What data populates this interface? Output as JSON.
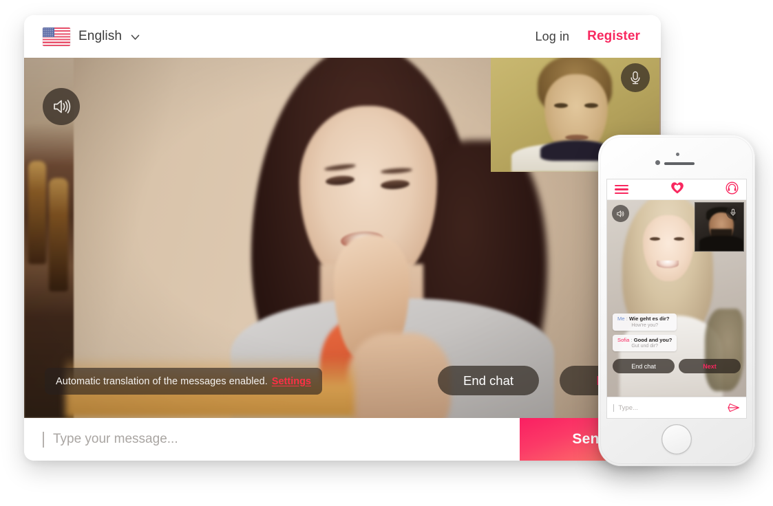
{
  "desktop": {
    "topbar": {
      "flag_icon": "us-flag-icon",
      "language": "English",
      "chevron_icon": "chevron-down-icon",
      "login_label": "Log in",
      "register_label": "Register"
    },
    "video": {
      "speaker_icon": "speaker-icon",
      "mic_icon": "microphone-icon",
      "notice_text": "Automatic translation of the messages enabled.",
      "notice_link": "Settings",
      "end_chat_label": "End chat",
      "next_label": "Next"
    },
    "composer": {
      "placeholder": "Type your message...",
      "value": "",
      "send_label": "Send"
    }
  },
  "phone": {
    "app_bar": {
      "menu_icon": "hamburger-menu-icon",
      "logo_icon": "heart-logo-icon",
      "support_icon": "headset-support-icon"
    },
    "video": {
      "speaker_icon": "speaker-icon",
      "mic_icon": "microphone-icon"
    },
    "messages": [
      {
        "sender": "Me",
        "separator": ":",
        "text": "Wie geht es dir?",
        "translation": "How're you?"
      },
      {
        "sender": "Sofia",
        "separator": ":",
        "text": "Good and you?",
        "translation": "Gut und dir?"
      }
    ],
    "actions": {
      "end_chat_label": "End chat",
      "next_label": "Next"
    },
    "composer": {
      "placeholder": "Type...",
      "value": "",
      "send_icon": "paper-plane-send-icon"
    }
  },
  "colors": {
    "accent_pink": "#f8285f",
    "settings_red": "#ff2f46",
    "text_dark": "#3b3b3b",
    "me_blue": "#6f8fd0"
  }
}
